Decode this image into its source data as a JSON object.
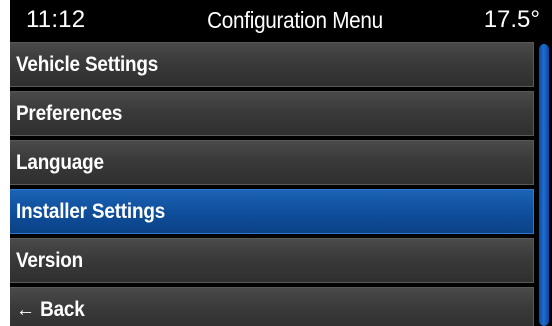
{
  "status": {
    "time": "11:12",
    "title": "Configuration Menu",
    "temperature": "17.5°"
  },
  "menu": {
    "items": [
      {
        "label": "Vehicle Settings",
        "selected": false
      },
      {
        "label": "Preferences",
        "selected": false
      },
      {
        "label": "Language",
        "selected": false
      },
      {
        "label": "Installer Settings",
        "selected": true
      },
      {
        "label": "Version",
        "selected": false
      },
      {
        "label": "Back",
        "arrow": "←",
        "selected": false
      }
    ]
  },
  "colors": {
    "background": "#000000",
    "item": "#3a3a3a",
    "selected": "#0f4f9c",
    "scrollbar": "#1e6fd0",
    "text": "#ffffff"
  }
}
